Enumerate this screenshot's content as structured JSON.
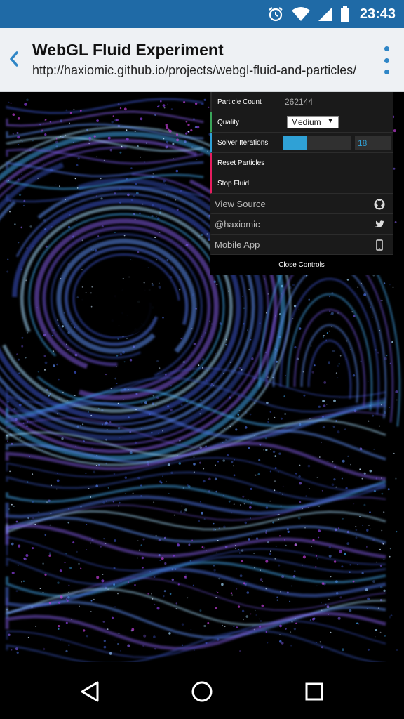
{
  "status_bar": {
    "time": "23:43",
    "icons": [
      "alarm-icon",
      "wifi-icon",
      "signal-icon",
      "battery-icon"
    ]
  },
  "browser": {
    "title": "WebGL Fluid Experiment",
    "url": "http://haxiomic.github.io/projects/webgl-fluid-and-particles/",
    "back_icon": "chevron-left-icon",
    "menu_icon": "overflow-menu-icon"
  },
  "controls": {
    "particle_count_label": "Particle Count",
    "particle_count_value": "262144",
    "quality_label": "Quality",
    "quality_value": "Medium",
    "solver_label": "Solver Iterations",
    "solver_value": "18",
    "solver_fraction": 0.35,
    "reset_label": "Reset Particles",
    "stop_label": "Stop Fluid",
    "view_source_label": "View Source",
    "twitter_label": "@haxiomic",
    "mobile_app_label": "Mobile App",
    "close_label": "Close Controls"
  },
  "nav": {
    "back": "back-triangle-icon",
    "home": "home-circle-icon",
    "recents": "recents-square-icon"
  },
  "colors": {
    "status_bar": "#1f6aa6",
    "accent_blue": "#2fa1d6",
    "green": "#3aa55a",
    "pink": "#e61d5f"
  }
}
